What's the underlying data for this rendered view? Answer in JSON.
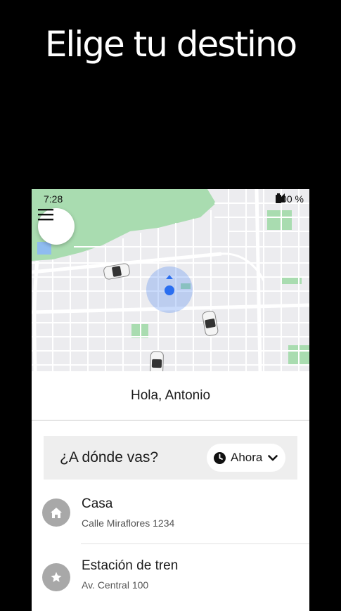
{
  "promo": {
    "headline": "Elige tu destino"
  },
  "status_bar": {
    "time": "7:28",
    "battery": "100 %"
  },
  "map": {
    "icons": [
      "menu-icon",
      "car-icon",
      "location-marker-icon"
    ],
    "colors": {
      "background": "#ececef",
      "road": "#ffffff",
      "park": "#9fd9a8",
      "location": "#2a6ef0"
    }
  },
  "greeting": "Hola, Antonio",
  "search": {
    "prompt": "¿A dónde vas?",
    "time_option": "Ahora",
    "icons": [
      "clock-icon",
      "chevron-down-icon"
    ]
  },
  "saved_places": [
    {
      "name": "Casa",
      "address": "Calle Miraflores 1234",
      "icon": "home-icon"
    },
    {
      "name": "Estación de tren",
      "address": "Av. Central 100",
      "icon": "star-icon"
    }
  ]
}
